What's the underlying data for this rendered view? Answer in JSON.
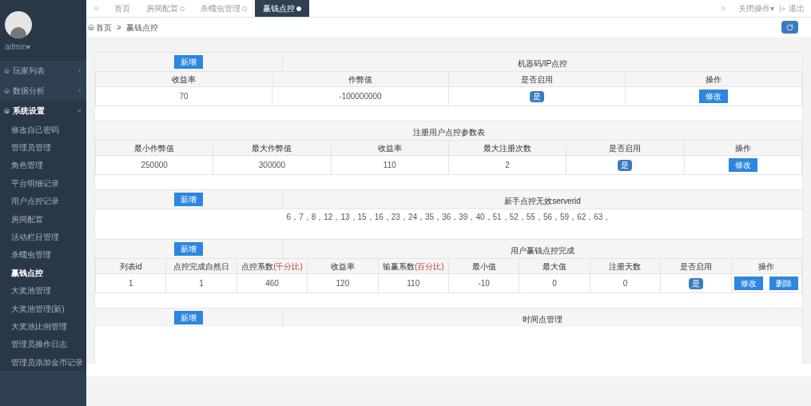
{
  "user": {
    "name": "admin",
    "caret": "▾"
  },
  "sidebar": {
    "items": [
      {
        "label": "玩家列表",
        "expanded": false
      },
      {
        "label": "数据分析",
        "expanded": false
      },
      {
        "label": "系统设置",
        "expanded": true,
        "children": [
          {
            "label": "修改自己密码",
            "selected": false
          },
          {
            "label": "管理员管理",
            "selected": false
          },
          {
            "label": "角色管理",
            "selected": false
          },
          {
            "label": "平台明细记录",
            "selected": false
          },
          {
            "label": "用户点控记录",
            "selected": false
          },
          {
            "label": "房间配置",
            "selected": false
          },
          {
            "label": "活动栏目管理",
            "selected": false
          },
          {
            "label": "杀蠕虫管理",
            "selected": false
          },
          {
            "label": "赢钱点控",
            "selected": true
          },
          {
            "label": "大奖池管理",
            "selected": false
          },
          {
            "label": "大奖池管理(新)",
            "selected": false
          },
          {
            "label": "大奖池比例管理",
            "selected": false
          },
          {
            "label": "管理员操作日志",
            "selected": false
          },
          {
            "label": "管理员添加金币记录",
            "selected": false
          }
        ]
      }
    ]
  },
  "tabs": [
    {
      "label": "首页",
      "closable": false,
      "selected": false
    },
    {
      "label": "房间配置",
      "closable": true,
      "selected": false
    },
    {
      "label": "杀蠕虫管理",
      "closable": true,
      "selected": false
    },
    {
      "label": "赢钱点控",
      "closable": true,
      "selected": true
    }
  ],
  "top_actions": {
    "close_menu": "关闭操作",
    "close_menu_caret": "▾",
    "logout": "退出"
  },
  "breadcrumb": [
    "首页",
    "赢钱点控"
  ],
  "breadcrumb_separator": ">",
  "sections": [
    {
      "title": "机器码/IP点控",
      "add_button": "新增",
      "columns": [
        {
          "label": "收益率"
        },
        {
          "label": "作弊值"
        },
        {
          "label": "是否启用"
        },
        {
          "label": "操作"
        }
      ],
      "rows": [
        {
          "cells": [
            "70",
            "-100000000"
          ],
          "enabled": true,
          "enabled_label": "是",
          "actions": [
            "修改"
          ]
        }
      ]
    },
    {
      "title": "注册用户点控参数表",
      "columns": [
        {
          "label": "最小作弊值"
        },
        {
          "label": "最大作弊值"
        },
        {
          "label": "收益率"
        },
        {
          "label": "最大注册次数"
        },
        {
          "label": "是否启用"
        },
        {
          "label": "操作"
        }
      ],
      "rows": [
        {
          "cells": [
            "250000",
            "300000",
            "110",
            "2"
          ],
          "enabled": true,
          "enabled_label": "是",
          "actions": [
            "修改"
          ]
        }
      ]
    },
    {
      "title": "新手点控无效serverid",
      "add_button": "新增",
      "text": "6，7，8，12，13，15，16，23，24，35，36，39，40，51，52，55，56，59，62，63，"
    },
    {
      "title": "用户赢钱点控完成",
      "add_button": "新增",
      "columns": [
        {
          "label": "列表id"
        },
        {
          "label": "点控完成自然日"
        },
        {
          "label": "点控系数",
          "note": "(千分比)"
        },
        {
          "label": "收益率"
        },
        {
          "label": "输赢系数",
          "note": "(百分比)"
        },
        {
          "label": "最小值"
        },
        {
          "label": "最大值"
        },
        {
          "label": "注册天数"
        },
        {
          "label": "是否启用"
        },
        {
          "label": "操作"
        }
      ],
      "rows": [
        {
          "cells": [
            "1",
            "1",
            "460",
            "120",
            "110",
            "-10",
            "0",
            "0"
          ],
          "enabled": true,
          "enabled_label": "是",
          "actions": [
            "修改",
            "删除"
          ]
        }
      ]
    },
    {
      "title": "时间点管理",
      "add_button": "新增"
    }
  ]
}
